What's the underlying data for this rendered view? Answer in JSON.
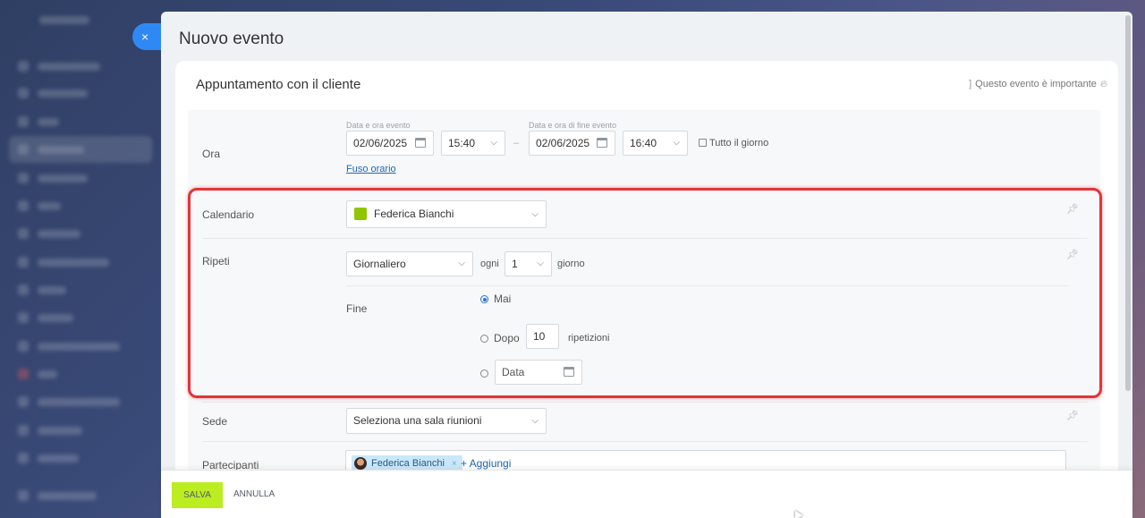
{
  "window": {
    "title": "Nuovo evento",
    "close_glyph": "×"
  },
  "event": {
    "name": "Appuntamento con il cliente",
    "important_label": "Questo evento è importante",
    "important_icon": "flame-icon"
  },
  "time": {
    "label": "Ora",
    "start_label": "Data e ora evento",
    "start_date": "02/06/2025",
    "start_time": "15:40",
    "separator": "–",
    "end_label": "Data e ora di fine evento",
    "end_date": "02/06/2025",
    "end_time": "16:40",
    "all_day_label": "Tutto il giorno",
    "all_day_checked": false,
    "timezone_link": "Fuso orario"
  },
  "calendar": {
    "label": "Calendario",
    "value": "Federica Bianchi",
    "color": "#8fc600"
  },
  "repeat": {
    "label": "Ripeti",
    "frequency": "Giornaliero",
    "every_label": "ogni",
    "interval": "1",
    "unit_label": "giorno",
    "end_label": "Fine",
    "options": {
      "never": "Mai",
      "after": "Dopo",
      "after_count": "10",
      "after_suffix": "ripetizioni",
      "date_placeholder": "Data"
    },
    "selected_end": "never"
  },
  "location": {
    "label": "Sede",
    "placeholder": "Seleziona una sala riunioni"
  },
  "participants": {
    "label": "Partecipanti",
    "people": [
      "Federica Bianchi"
    ],
    "remove_glyph": "×",
    "add_label": "+ Aggiungi"
  },
  "footer": {
    "save_label": "SALVA",
    "cancel_label": "ANNULLA"
  },
  "colors": {
    "accent_blue": "#2f89f5",
    "save_green": "#bbed21",
    "highlight_red": "#e0353a",
    "link_blue": "#2066b0"
  }
}
